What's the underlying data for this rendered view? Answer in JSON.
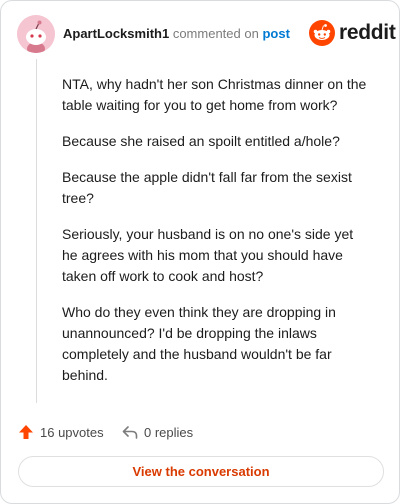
{
  "comment": {
    "username": "ApartLocksmith1",
    "action_text": "commented on",
    "post_link": "post",
    "paragraphs": [
      "NTA, why hadn't her son Christmas dinner on the table waiting for you to get home from work?",
      "Because she raised an spoilt entitled a/hole?",
      "Because the apple didn't fall far from the sexist tree?",
      "Seriously, your husband is on no one's side yet he agrees with his mom that you should have taken off work to cook and host?",
      "Who do they even think they are dropping in unannounced? I'd be dropping the inlaws completely and the husband wouldn't be far behind."
    ],
    "upvotes_label": "16 upvotes",
    "replies_label": "0 replies"
  },
  "brand": {
    "name": "reddit",
    "color": "#ff4500"
  },
  "footer": {
    "view_button_label": "View the conversation"
  },
  "colors": {
    "accent": "#d93a00",
    "upvote": "#ff4500",
    "link": "#0079d3",
    "avatar_bg": "#f5c6d1"
  },
  "icons": {
    "avatar": "snoo-avatar-icon",
    "logo": "reddit-logo-icon",
    "upvote": "upvote-arrow-icon",
    "reply": "reply-icon"
  }
}
